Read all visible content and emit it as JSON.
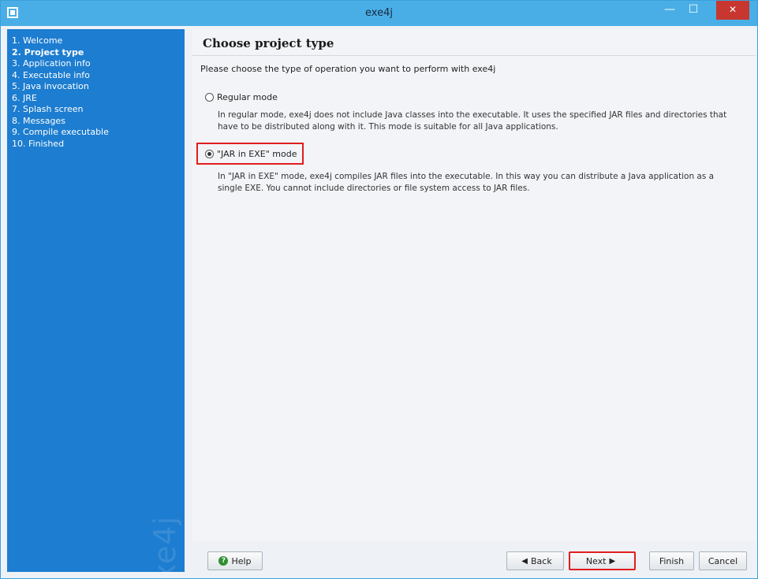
{
  "window": {
    "title": "exe4j",
    "minimize_glyph": "—",
    "maximize_glyph": "☐",
    "close_glyph": "✕"
  },
  "sidebar": {
    "steps": [
      {
        "label": "1. Welcome"
      },
      {
        "label": "2. Project type"
      },
      {
        "label": "3. Application info"
      },
      {
        "label": "4. Executable info"
      },
      {
        "label": "5. Java invocation"
      },
      {
        "label": "6. JRE"
      },
      {
        "label": "7. Splash screen"
      },
      {
        "label": "8. Messages"
      },
      {
        "label": "9. Compile executable"
      },
      {
        "label": "10. Finished"
      }
    ],
    "active_index": 1,
    "watermark": "exe4j"
  },
  "main": {
    "title": "Choose project type",
    "intro": "Please choose the type of operation you want to perform with exe4j",
    "options": [
      {
        "label": "Regular mode",
        "selected": false,
        "description_line1": "In regular mode, exe4j does not include Java classes into the executable. It uses the specified JAR files and directories that",
        "description_line2": "have to be distributed along with it. This mode is suitable for all Java applications."
      },
      {
        "label": "\"JAR in EXE\" mode",
        "selected": true,
        "description_line1": "In \"JAR in EXE\" mode, exe4j compiles JAR files into the executable. In this way you can distribute a Java application as a",
        "description_line2": "single EXE. You cannot include directories or file system access to JAR files."
      }
    ]
  },
  "buttons": {
    "help": "Help",
    "back": "Back",
    "next": "Next",
    "finish": "Finish",
    "cancel": "Cancel"
  },
  "colors": {
    "titlebar": "#4aaee6",
    "sidebar": "#1d7dd0",
    "highlight": "#e01e1e"
  }
}
